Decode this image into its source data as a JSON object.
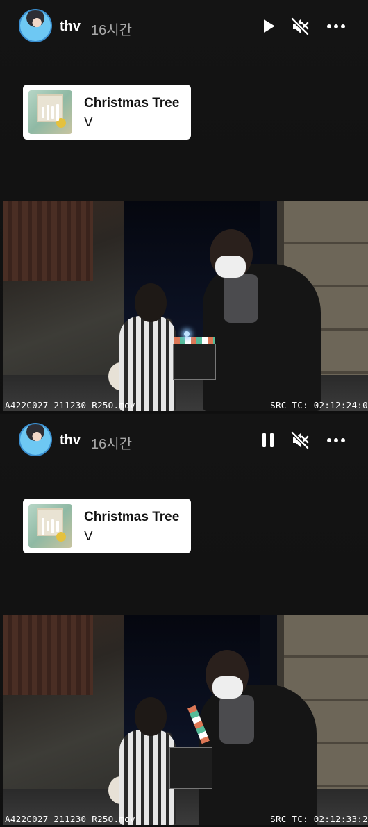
{
  "frames": [
    {
      "header": {
        "username": "thv",
        "time_ago": "16시간",
        "playback_state": "paused"
      },
      "music": {
        "title": "Christmas Tree",
        "artist": "V"
      },
      "video": {
        "clip_name": "A422C027_211230_R25O.mov",
        "timecode": "SRC TC: 02:12:24:0"
      }
    },
    {
      "header": {
        "username": "thv",
        "time_ago": "16시간",
        "playback_state": "playing"
      },
      "music": {
        "title": "Christmas Tree",
        "artist": "V"
      },
      "video": {
        "clip_name": "A422C027_211230_R25O.mov",
        "timecode": "SRC TC: 02:12:33:2"
      }
    }
  ],
  "icons": {
    "play": "play-icon",
    "pause": "pause-icon",
    "mute": "speaker-muted-icon",
    "more": "more-horizontal-icon",
    "equalizer": "music-equalizer-icon"
  },
  "colors": {
    "background": "#121212",
    "card": "#ffffff",
    "time": "#a8a8a8",
    "avatar_ring": "#3b8fd0"
  }
}
